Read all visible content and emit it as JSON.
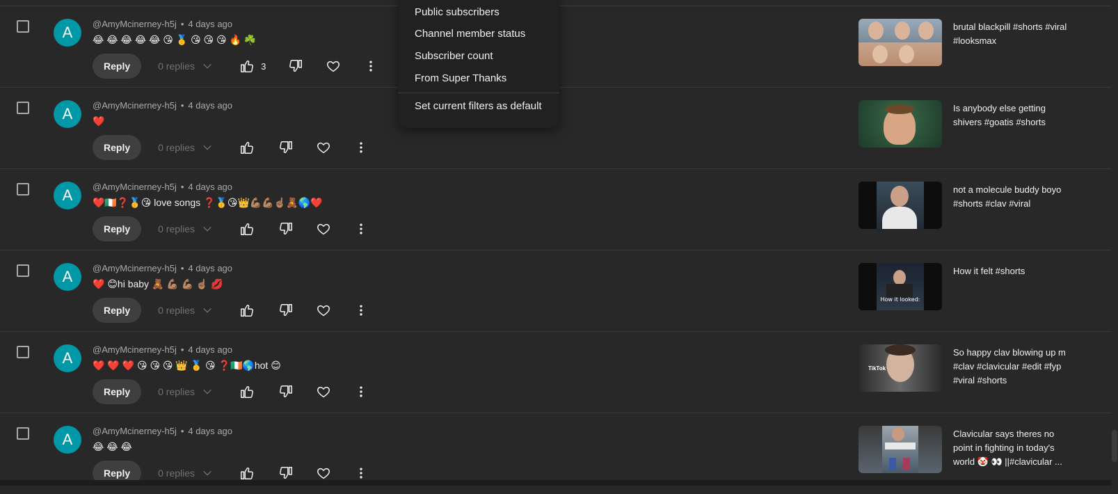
{
  "menu": {
    "items": [
      "Public subscribers",
      "Channel member status",
      "Subscriber count",
      "From Super Thanks"
    ],
    "default_action": "Set current filters as default"
  },
  "reply_label": "Reply",
  "comments": [
    {
      "avatar": "A",
      "author": "@AmyMcinerney-h5j",
      "time": "4 days ago",
      "text": "😂 😂 😂 😂 😂 😘 🥇 😘 😘 😘 🔥 ☘️",
      "replies": "0 replies",
      "likes": "3",
      "video_title": "brutal blackpill #shorts #viral #looksmax"
    },
    {
      "avatar": "A",
      "author": "@AmyMcinerney-h5j",
      "time": "4 days ago",
      "text": "❤️",
      "replies": "0 replies",
      "likes": "",
      "video_title": "Is anybody else getting shivers #goatis #shorts"
    },
    {
      "avatar": "A",
      "author": "@AmyMcinerney-h5j",
      "time": "4 days ago",
      "text": "❤️🇮🇪❓🥇😘 love songs ❓🥇😘👑💪🏽💪🏽☝🏽🧸🌎❤️",
      "replies": "0 replies",
      "likes": "",
      "video_title": "not a molecule buddy boyo #shorts #clav #viral"
    },
    {
      "avatar": "A",
      "author": "@AmyMcinerney-h5j",
      "time": "4 days ago",
      "text": "❤️ 😊hi baby 🧸 💪🏽 💪🏽 ☝🏽 💋",
      "replies": "0 replies",
      "likes": "",
      "video_title": "How it felt #shorts"
    },
    {
      "avatar": "A",
      "author": "@AmyMcinerney-h5j",
      "time": "4 days ago",
      "text": "❤️ ❤️ ❤️ 😘 😘 😘 👑 🥇 😘 ❓🇮🇪🌎hot 😊",
      "replies": "0 replies",
      "likes": "",
      "video_title": "So happy clav blowing up m #clav #clavicular #edit #fyp #viral  #shorts"
    },
    {
      "avatar": "A",
      "author": "@AmyMcinerney-h5j",
      "time": "4 days ago",
      "text": "😂 😂 😂",
      "replies": "0 replies",
      "likes": "",
      "video_title": "Clavicular says theres no point in fighting in today's world 🤡 👀 ||#clavicular ..."
    }
  ],
  "thumb_captions": {
    "c3": "How it looked:",
    "c4": "TikTok"
  },
  "colors": {
    "avatar": "#0097a7",
    "background": "#282828",
    "menu": "#212121"
  }
}
